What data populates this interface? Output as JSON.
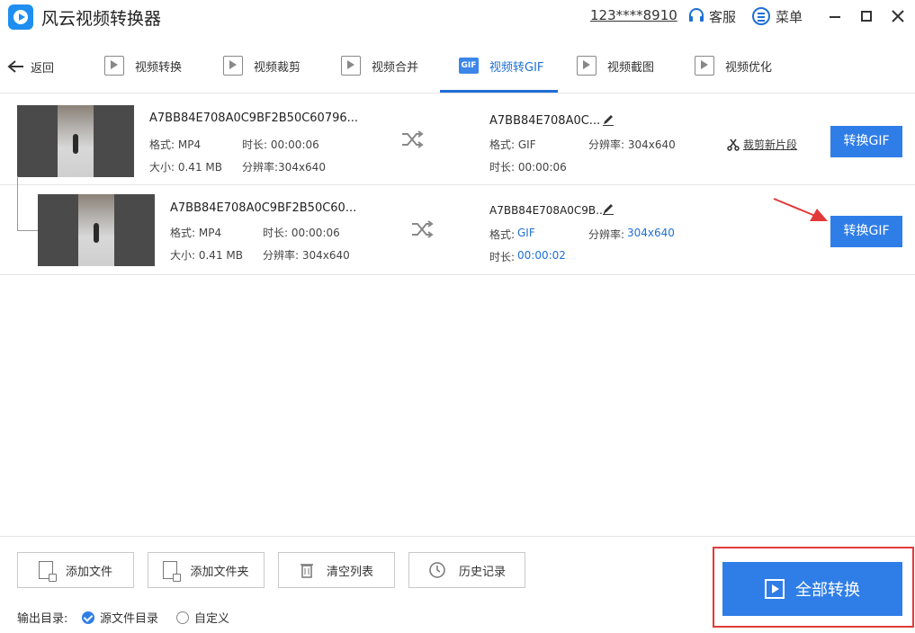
{
  "app": {
    "title": "风云视频转换器",
    "account": "123****8910",
    "service_label": "客服",
    "menu_label": "菜单"
  },
  "nav": {
    "back_label": "返回",
    "tabs": [
      {
        "label": "视频转换"
      },
      {
        "label": "视频裁剪"
      },
      {
        "label": "视频合并"
      },
      {
        "label": "视频转GIF",
        "badge": "GIF"
      },
      {
        "label": "视频截图"
      },
      {
        "label": "视频优化"
      }
    ],
    "active_tab": "视频转GIF"
  },
  "files": [
    {
      "source_name": "A7BB84E708A0C9BF2B50C60796...",
      "format": "格式: MP4",
      "duration": "时长: 00:00:06",
      "size": "大小: 0.41 MB",
      "resolution": "分辨率:304x640",
      "output_name": "A7BB84E708A0C...",
      "output_format": "格式: GIF",
      "output_resolution": "分辨率: 304x640",
      "output_duration": "时长: 00:00:06",
      "trim_label": "裁剪新片段",
      "convert_label": "转换GIF"
    },
    {
      "source_name": "A7BB84E708A0C9BF2B50C60...",
      "format": "格式: MP4",
      "duration": "时长: 00:00:06",
      "size": "大小: 0.41 MB",
      "resolution": "分辨率: 304x640",
      "output_name": "A7BB84E708A0C9B...",
      "output_format_label": "格式:",
      "output_format_value": "GIF",
      "output_resolution_label": "分辨率:",
      "output_resolution_value": "304x640",
      "output_duration_label": "时长:",
      "output_duration_value": "00:00:02",
      "convert_label": "转换GIF"
    }
  ],
  "toolbar": {
    "add_file": "添加文件",
    "add_folder": "添加文件夹",
    "clear_list": "清空列表",
    "history": "历史记录"
  },
  "output": {
    "label": "输出目录:",
    "option_source": "源文件目录",
    "option_custom": "自定义",
    "selected": "源文件目录"
  },
  "convert_all_label": "全部转换",
  "colors": {
    "accent": "#2f7ee8",
    "highlight": "#e23a3a"
  }
}
